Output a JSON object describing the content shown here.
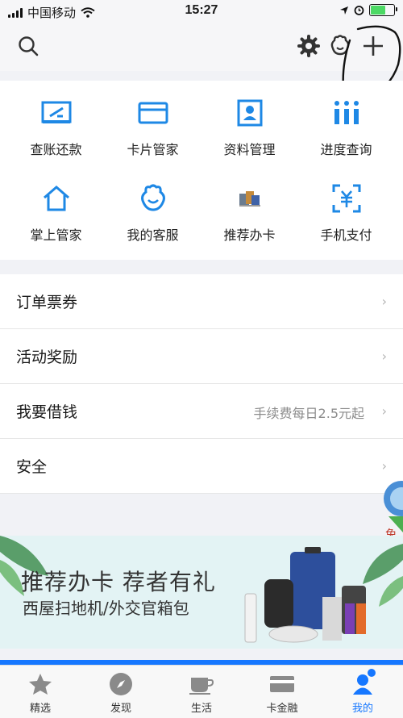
{
  "status_bar": {
    "carrier": "中国移动",
    "time": "15:27"
  },
  "navbar": {
    "icons": [
      "search-icon",
      "settings-gear-icon",
      "customer-service-icon",
      "add-plus-icon"
    ]
  },
  "grid": {
    "items": [
      {
        "label": "查账还款",
        "icon": "bill-repay-icon"
      },
      {
        "label": "卡片管家",
        "icon": "card-icon"
      },
      {
        "label": "资料管理",
        "icon": "profile-card-icon"
      },
      {
        "label": "进度查询",
        "icon": "progress-bars-icon"
      },
      {
        "label": "掌上管家",
        "icon": "home-icon"
      },
      {
        "label": "我的客服",
        "icon": "customer-service-icon"
      },
      {
        "label": "推荐办卡",
        "icon": "recommend-card-icon"
      },
      {
        "label": "手机支付",
        "icon": "mobile-pay-icon"
      }
    ]
  },
  "list": {
    "rows": [
      {
        "label": "订单票券",
        "value": ""
      },
      {
        "label": "活动奖励",
        "value": ""
      },
      {
        "label": "我要借钱",
        "value": "手续费每日2.5元起"
      },
      {
        "label": "安全",
        "value": ""
      }
    ]
  },
  "banner": {
    "headline": "推荐办卡 荐者有礼",
    "subline": "西屋扫地机/外交官箱包",
    "corner_text": "免"
  },
  "tabbar": {
    "tabs": [
      {
        "label": "精选",
        "icon": "star-icon"
      },
      {
        "label": "发现",
        "icon": "compass-icon"
      },
      {
        "label": "生活",
        "icon": "coffee-cup-icon"
      },
      {
        "label": "卡金融",
        "icon": "card-finance-icon"
      },
      {
        "label": "我的",
        "icon": "profile-icon"
      }
    ],
    "active_index": 4
  },
  "colors": {
    "accent": "#1677ff",
    "icon_blue": "#1e88e5"
  }
}
